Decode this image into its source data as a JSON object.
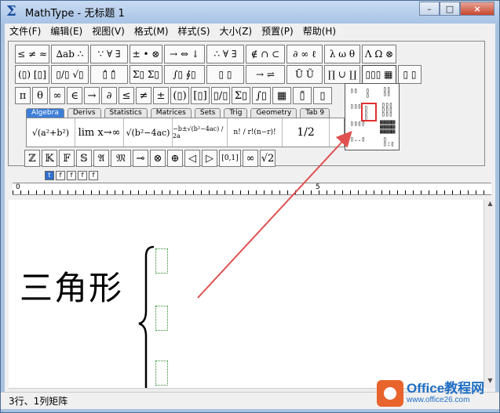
{
  "window": {
    "title": "MathType - 无标题 1",
    "app_icon": "Σ",
    "buttons": [
      "–",
      "□",
      "×"
    ]
  },
  "menu": [
    "文件(F)",
    "编辑(E)",
    "视图(V)",
    "格式(M)",
    "样式(S)",
    "大小(Z)",
    "预置(P)",
    "帮助(H)"
  ],
  "palette": {
    "row1": [
      "≤ ≠ ≈",
      "∆ab ∴",
      "∵ ∀ ∃",
      "± • ⊗",
      "→ ⇔ ↓",
      "∴ ∀ ∃",
      "∉ ∩ ⊂",
      "∂ ∞ ℓ",
      "λ ω θ",
      "Λ Ω ⊗"
    ],
    "row2": [
      "(▯) [▯]",
      "▯/▯ √▯",
      "▯̂ ▯̂",
      "Σ▯ Σ▯",
      "∫▯ ∮▯",
      "▯ ▯",
      "→ ⇌",
      "Ū Ũ",
      "∏ ∪ ∐",
      "▯▯▯ ▦",
      "▯ ▯"
    ],
    "row3": [
      "π",
      "θ",
      "∞",
      "∈",
      "→",
      "∂",
      "≤",
      "≠",
      "±",
      "(▯)",
      "[▯]",
      "▯/▯",
      "Σ▯",
      "∫▯",
      "▦",
      "▯̃",
      "▯"
    ],
    "tabs": [
      "Algebra",
      "Derivs",
      "Statistics",
      "Matrices",
      "Sets",
      "Trig",
      "Geometry",
      "Tab 9"
    ],
    "templates": [
      "√(a²+b²)",
      "lim x→∞",
      "√(b²−4ac)",
      "−b±√(b²−4ac) / 2a",
      "n! / r!(n−r)!",
      "1/2"
    ],
    "row5": [
      "ℤ",
      "𝕂",
      "𝔽",
      "𝕊",
      "𝔄",
      "𝔐",
      "⊸",
      "⊗",
      "⊕",
      "◁",
      "▷",
      "[0,1]",
      "∞",
      "√2"
    ],
    "size_buttons": [
      "t",
      "f",
      "f",
      "f",
      "f"
    ]
  },
  "ruler": {
    "labels": [
      "0",
      "5"
    ]
  },
  "editor": {
    "text": "三角形"
  },
  "status": {
    "text": "3行、1列矩阵"
  },
  "watermark": {
    "name": "Office教程网",
    "url": "www.office26.com"
  },
  "colors": {
    "highlight": "#e03030",
    "arrow": "#e05050",
    "tab_active": "#3d7fd8"
  }
}
